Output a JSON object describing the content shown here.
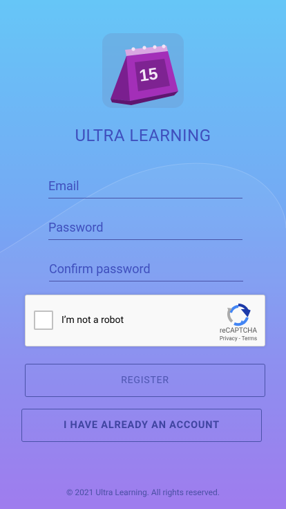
{
  "app": {
    "title": "ULTRA LEARNING",
    "logo_day": "15",
    "icon": "calendar-icon"
  },
  "form": {
    "email": {
      "placeholder": "Email",
      "value": ""
    },
    "password": {
      "placeholder": "Password",
      "value": ""
    },
    "confirm_password": {
      "placeholder": "Confirm password",
      "value": ""
    }
  },
  "recaptcha": {
    "label": "I’m not a robot",
    "brand": "reCAPTCHA",
    "privacy": "Privacy",
    "separator": " - ",
    "terms": "Terms",
    "checked": false,
    "icon": "recaptcha-icon"
  },
  "buttons": {
    "register": "REGISTER",
    "have_account": "I HAVE ALREADY AN ACCOUNT"
  },
  "footer": {
    "text": "© 2021 Ultra Learning. All rights reserved."
  },
  "colors": {
    "accent": "#3f4fbd",
    "gradient_top": "#66c6f7",
    "gradient_bottom": "#9a76ee",
    "logo_purple": "#a32fb8"
  }
}
